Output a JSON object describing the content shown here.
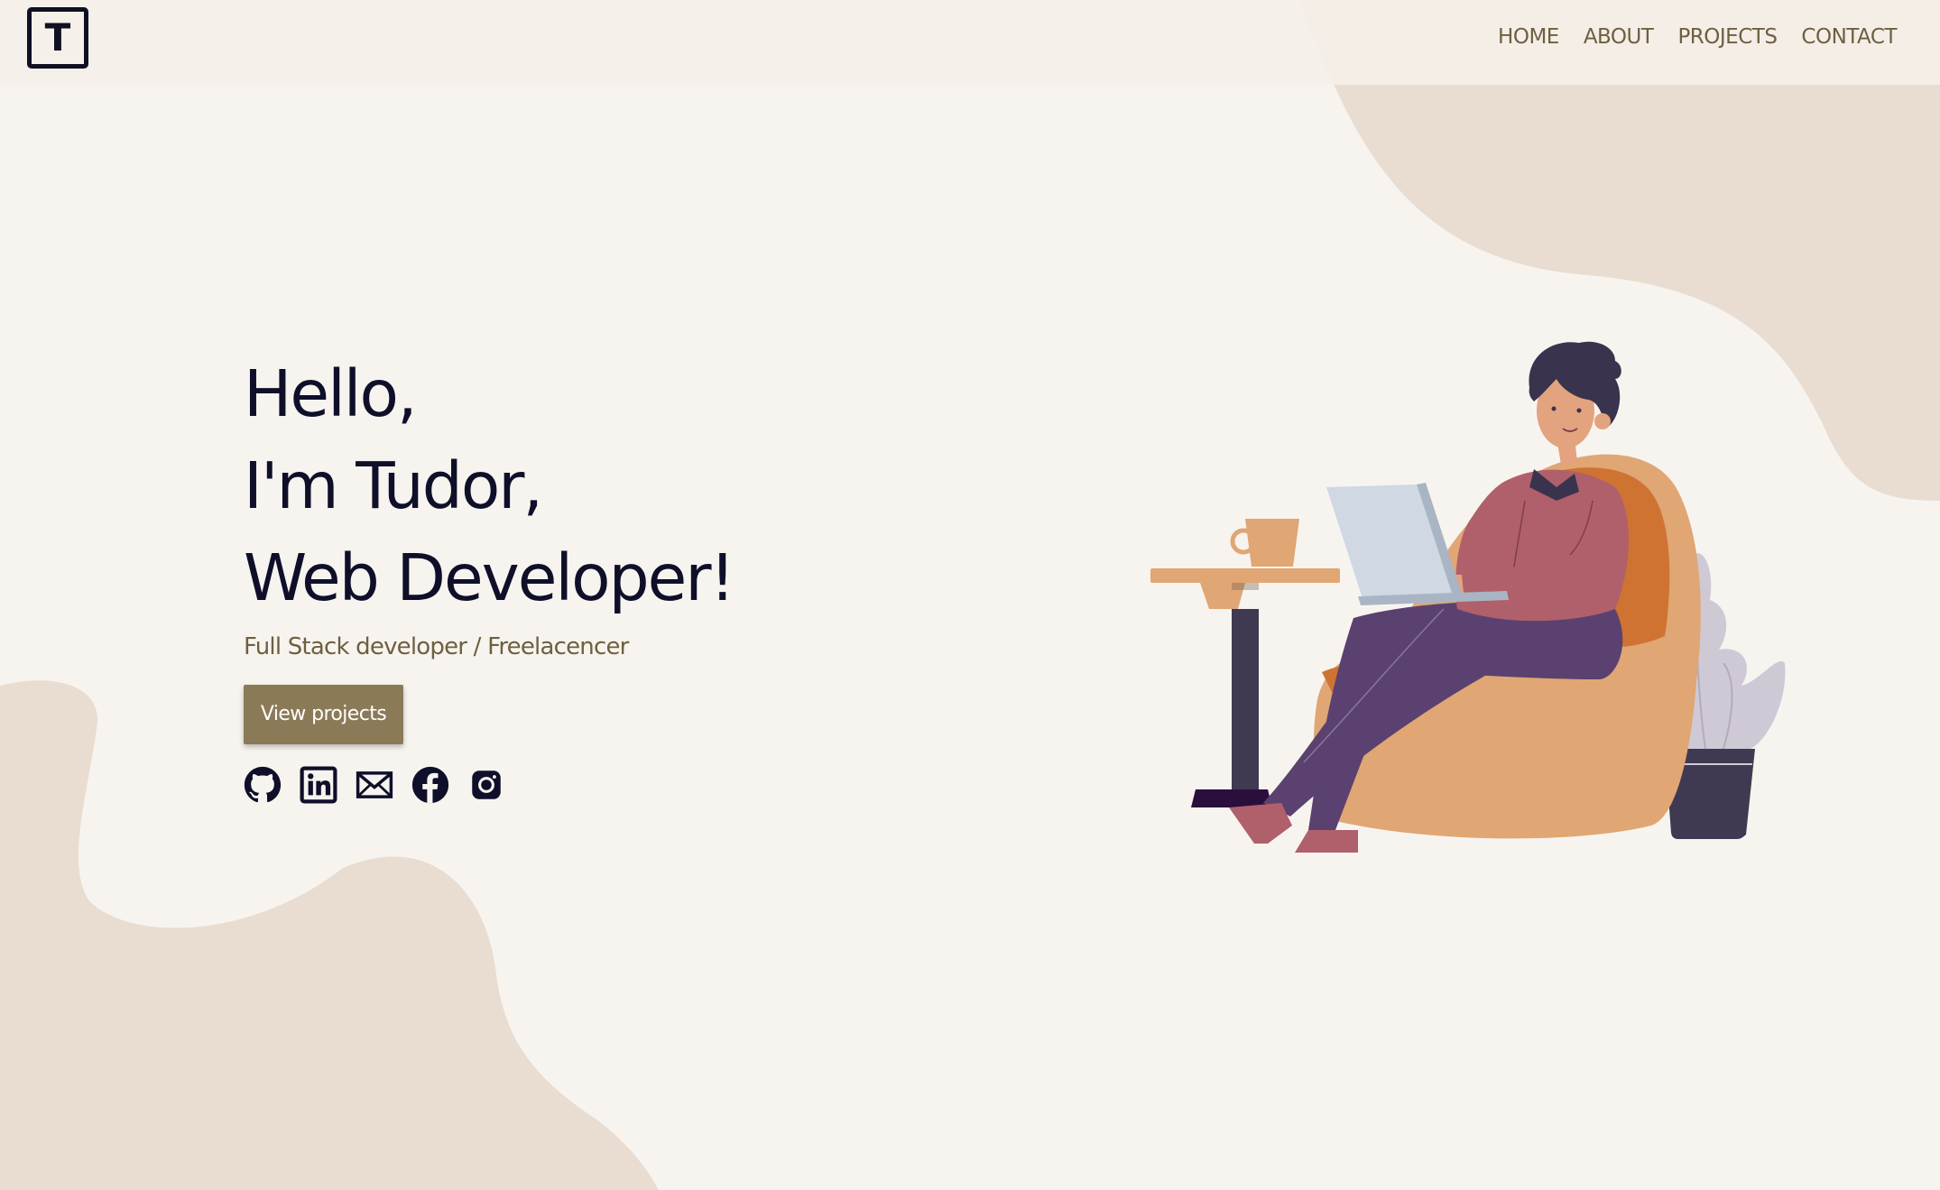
{
  "header": {
    "logo_letter": "T",
    "nav": [
      {
        "label": "HOME"
      },
      {
        "label": "ABOUT"
      },
      {
        "label": "PROJECTS"
      },
      {
        "label": "CONTACT"
      }
    ]
  },
  "hero": {
    "line1": "Hello,",
    "line2": "I'm Tudor,",
    "line3": "Web Developer!",
    "subtitle": "Full Stack developer / Freelacencer",
    "cta_label": "View projects"
  },
  "socials": [
    {
      "icon": "github-icon"
    },
    {
      "icon": "linkedin-icon"
    },
    {
      "icon": "email-icon"
    },
    {
      "icon": "facebook-icon"
    },
    {
      "icon": "instagram-icon"
    }
  ],
  "colors": {
    "background": "#f7f4ef",
    "blob": "#e8ddd0",
    "heading": "#0f0f2a",
    "accent": "#6e5f3f",
    "button": "#8b7a57"
  }
}
